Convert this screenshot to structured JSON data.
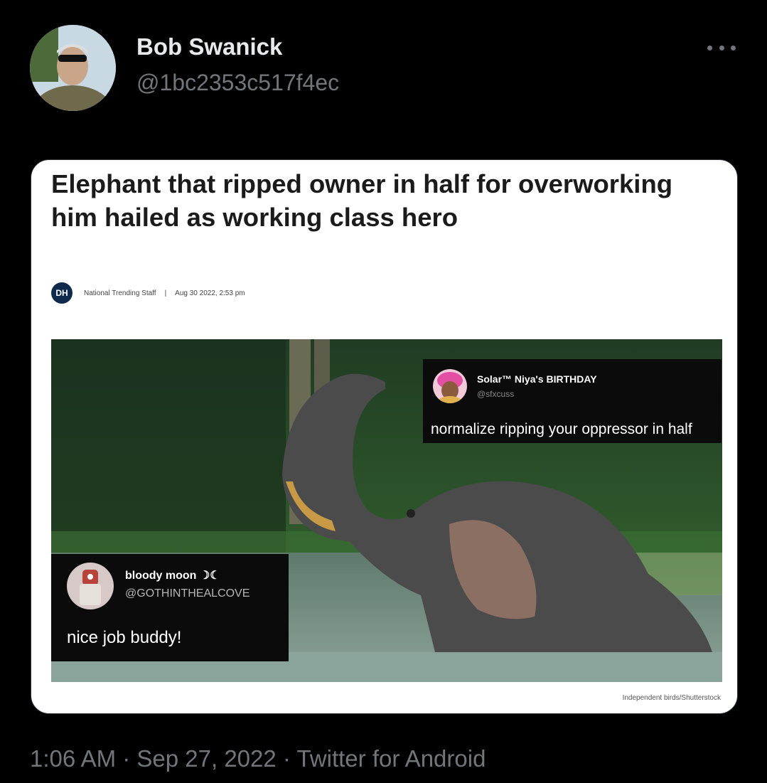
{
  "tweet": {
    "display_name": "Bob Swanick",
    "handle": "@1bc2353c517f4ec",
    "more_icon": "more-horizontal-icon",
    "timestamp": "1:06 AM · Sep 27, 2022 · Twitter for Android"
  },
  "article": {
    "headline": "Elephant that ripped owner in half for overworking him hailed as working class hero",
    "logo_text": "DH",
    "author": "National Trending Staff",
    "separator": "|",
    "date": "Aug 30 2022, 2:53 pm",
    "photo_credit": "Independent birds/Shutterstock"
  },
  "quotes": [
    {
      "name": "Solar™ Niya's BIRTHDAY",
      "handle": "@sfxcuss",
      "text": "normalize ripping your oppressor in half"
    },
    {
      "name": "bloody moon ☽☾",
      "handle": "@GOTHINTHEALCOVE",
      "text": "nice job buddy!"
    }
  ]
}
